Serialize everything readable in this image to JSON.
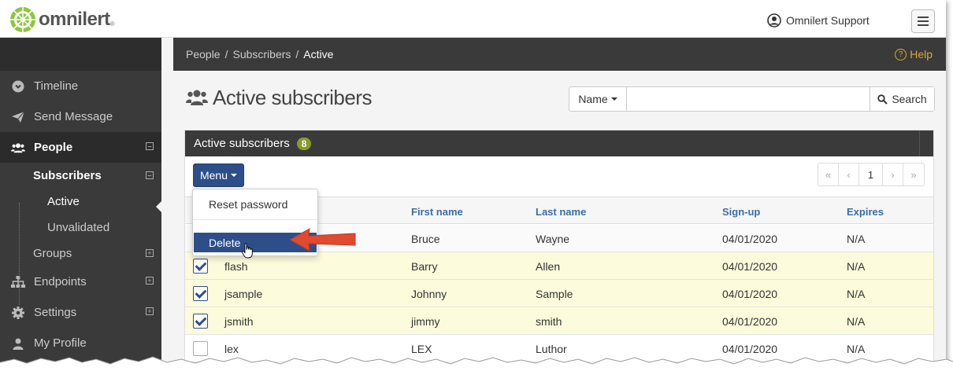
{
  "brand": {
    "name": "omnilert",
    "reg": "®",
    "accent": "#8dc63f"
  },
  "header": {
    "user_label": "Omnilert Support"
  },
  "sidebar": {
    "items": [
      {
        "label": "Timeline",
        "icon": "timeline-icon"
      },
      {
        "label": "Send Message",
        "icon": "paper-plane-icon"
      },
      {
        "label": "People",
        "icon": "users-icon",
        "toggle": "⊟"
      },
      {
        "label": "Endpoints",
        "icon": "sitemap-icon",
        "toggle": "⊞"
      },
      {
        "label": "Settings",
        "icon": "gear-icon",
        "toggle": "⊞"
      },
      {
        "label": "My Profile",
        "icon": "user-icon"
      }
    ],
    "sub": {
      "subscribers": "Subscribers",
      "active": "Active",
      "unvalidated": "Unvalidated",
      "groups": "Groups"
    }
  },
  "breadcrumb": {
    "items": [
      "People",
      "Subscribers"
    ],
    "current": "Active",
    "separator": "/",
    "help": "Help"
  },
  "page": {
    "title": "Active subscribers"
  },
  "search": {
    "field": "Name",
    "placeholder": "",
    "button": "Search"
  },
  "panel": {
    "title": "Active subscribers",
    "count": "8",
    "menu_label": "Menu"
  },
  "pager": {
    "first": "«",
    "prev": "‹",
    "page": "1",
    "next": "›",
    "last": "»"
  },
  "table": {
    "columns": [
      "First name",
      "Last name",
      "Sign-up",
      "Expires"
    ],
    "rows": [
      {
        "user": "",
        "first": "Bruce",
        "last": "Wayne",
        "signup": "04/01/2020",
        "expires": "N/A",
        "checked": false
      },
      {
        "user": "flash",
        "first": "Barry",
        "last": "Allen",
        "signup": "04/01/2020",
        "expires": "N/A",
        "checked": true
      },
      {
        "user": "jsample",
        "first": "Johnny",
        "last": "Sample",
        "signup": "04/01/2020",
        "expires": "N/A",
        "checked": true
      },
      {
        "user": "jsmith",
        "first": "jimmy",
        "last": "smith",
        "signup": "04/01/2020",
        "expires": "N/A",
        "checked": true
      },
      {
        "user": "lex",
        "first": "LEX",
        "last": "Luthor",
        "signup": "04/01/2020",
        "expires": "N/A",
        "checked": false
      }
    ]
  },
  "menu_dropdown": {
    "reset_password": "Reset password",
    "delete": "Delete"
  },
  "colors": {
    "dark": "#3a3a3a",
    "primary": "#2e4e8a",
    "selected_row": "#fcfcdc",
    "callout_arrow": "#e04a2f",
    "help": "#d8a838"
  }
}
